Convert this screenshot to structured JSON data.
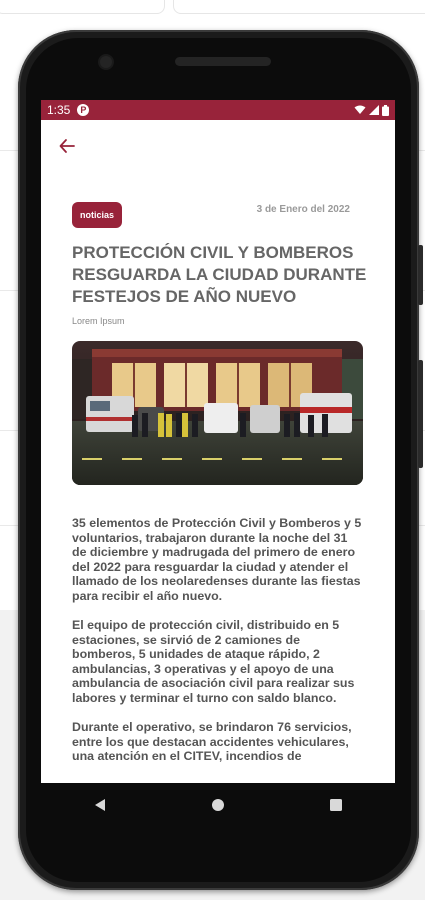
{
  "status_bar": {
    "time": "1:35",
    "app_icon": "p-circle-icon",
    "icons": [
      "wifi-icon",
      "signal-icon",
      "battery-icon"
    ],
    "color": "#98233a"
  },
  "app_bar": {
    "back_icon": "arrow-left-icon",
    "accent": "#98233a"
  },
  "article": {
    "category": "noticias",
    "date": "3 de Enero del 2022",
    "title": "PROTECCIÓN CIVIL Y BOMBEROS RESGUARDA LA CIUDAD DURANTE FESTEJOS DE AÑO NUEVO",
    "author": "Lorem Ipsum",
    "paragraphs": [
      "35 elementos de Protección Civil y Bomberos y 5 voluntarios,  trabajaron durante la noche del 31 de diciembre y madrugada del primero de enero del 2022 para resguardar la ciudad y atender el llamado de los neolaredenses durante las fiestas para recibir el año nuevo.",
      "El equipo de protección civil, distribuido en 5 estaciones, se sirvió de  2 camiones de bomberos, 5 unidades de ataque rápido, 2 ambulancias, 3 operativas y el apoyo de una ambulancia de asociación civil para realizar sus labores y terminar el turno con saldo blanco.",
      "Durante el operativo, se brindaron 76 servicios, entre los que destacan  accidentes vehiculares, una atención en el CITEV, incendios de"
    ]
  },
  "nav_bar": {
    "icons": [
      "back-triangle-icon",
      "home-circle-icon",
      "recents-square-icon"
    ]
  }
}
